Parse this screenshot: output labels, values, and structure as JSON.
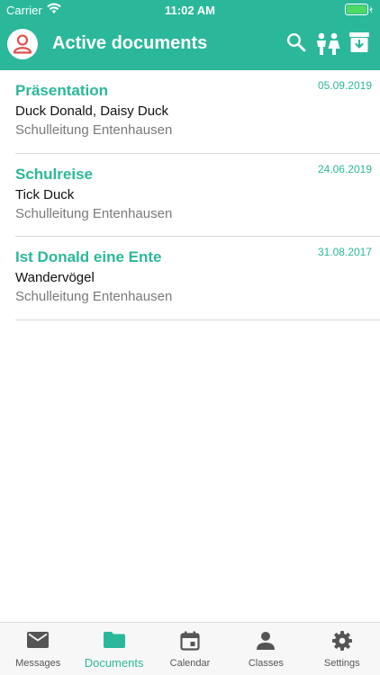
{
  "status_bar": {
    "carrier": "Carrier",
    "time": "11:02 AM"
  },
  "header": {
    "title": "Active documents",
    "icons": [
      "user-avatar-icon",
      "search-icon",
      "kids-icon",
      "archive-download-icon"
    ]
  },
  "colors": {
    "accent": "#2bb89a",
    "avatar_red": "#e0524d",
    "battery_green": "#4cd964"
  },
  "documents": [
    {
      "title": "Präsentation",
      "date": "05.09.2019",
      "author": "Duck Donald, Daisy Duck",
      "school": "Schulleitung Entenhausen"
    },
    {
      "title": "Schulreise",
      "date": "24.06.2019",
      "author": "Tick Duck",
      "school": "Schulleitung Entenhausen"
    },
    {
      "title": "Ist Donald eine Ente",
      "date": "31.08.2017",
      "author": "Wandervögel",
      "school": "Schulleitung Entenhausen"
    }
  ],
  "tabbar": {
    "active": "Documents",
    "tabs": [
      {
        "label": "Messages",
        "icon": "envelope-icon"
      },
      {
        "label": "Documents",
        "icon": "folder-icon"
      },
      {
        "label": "Calendar",
        "icon": "calendar-icon"
      },
      {
        "label": "Classes",
        "icon": "person-icon"
      },
      {
        "label": "Settings",
        "icon": "gear-icon"
      }
    ]
  }
}
